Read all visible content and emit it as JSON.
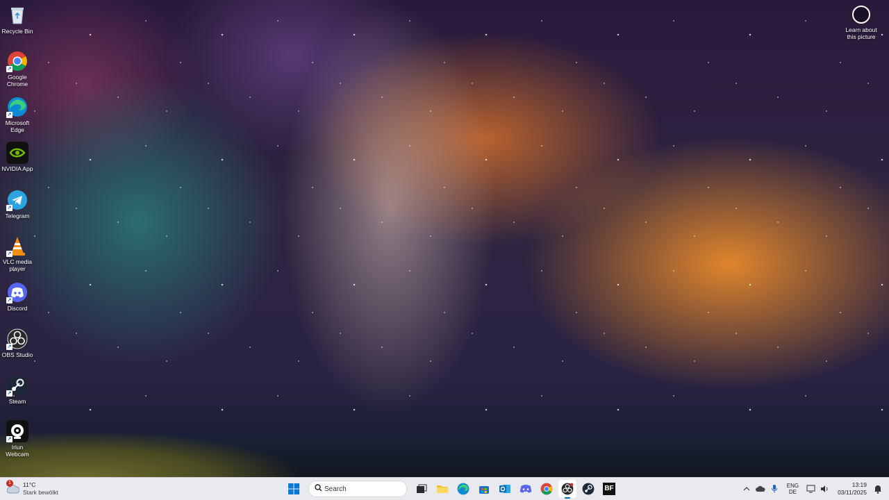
{
  "desktop": {
    "icons": [
      {
        "label": "Recycle Bin"
      },
      {
        "label": "Google Chrome"
      },
      {
        "label": "Microsoft Edge"
      },
      {
        "label": "NVIDIA App"
      },
      {
        "label": "Telegram"
      },
      {
        "label": "VLC media player"
      },
      {
        "label": "Discord"
      },
      {
        "label": "OBS Studio"
      },
      {
        "label": "Steam"
      },
      {
        "label": "Iriun Webcam"
      }
    ],
    "learn_about": "Learn about this picture"
  },
  "taskbar": {
    "weather": {
      "badge": "1",
      "temperature": "11°C",
      "condition": "Stark bewölkt"
    },
    "search_placeholder": "Search",
    "bf_label": "BF",
    "language": {
      "line1": "ENG",
      "line2": "DE"
    },
    "clock": {
      "time": "13:19",
      "date": "03/11/2025"
    }
  }
}
